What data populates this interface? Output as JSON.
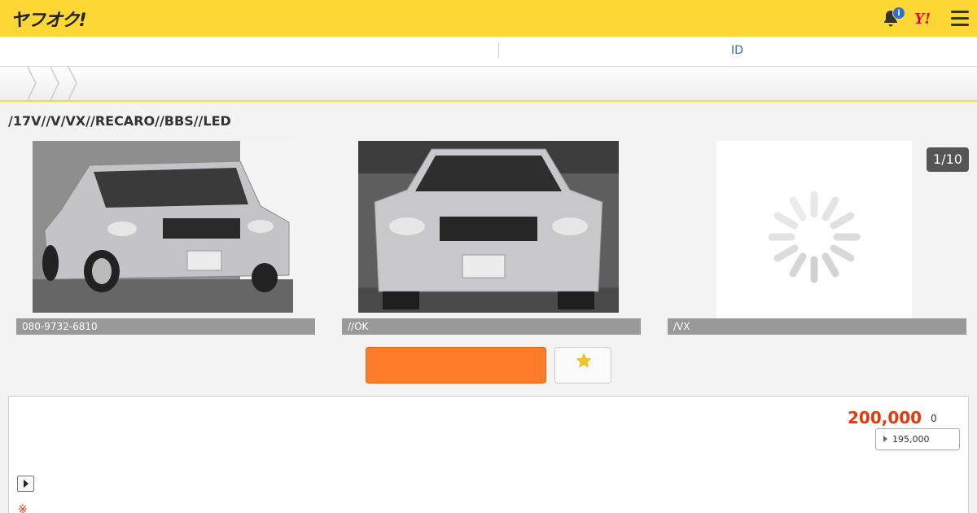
{
  "header": {
    "logo": "ヤフオク!",
    "notification_count": "i",
    "yahoo_logo": "Y!"
  },
  "subbar": {
    "id_link": "ID"
  },
  "listing": {
    "title": "/17V//V/VX//RECARO//BBS//LED",
    "photo_counter": "1/10",
    "captions": [
      "080-9732-6810",
      "//OK",
      "/VX"
    ]
  },
  "price": {
    "current": "200,000",
    "bids": "0",
    "buyout": "195,000"
  },
  "note_mark": "※",
  "colors": {
    "header_bg": "#fdd835",
    "accent_orange": "#ff7c2b",
    "price_red": "#e6380c",
    "link_blue": "#2a69b9"
  },
  "icons": [
    "bell-icon",
    "yahoo-icon",
    "menu-icon",
    "chevron-icon",
    "star-icon",
    "loading-spinner-icon",
    "play-icon"
  ]
}
